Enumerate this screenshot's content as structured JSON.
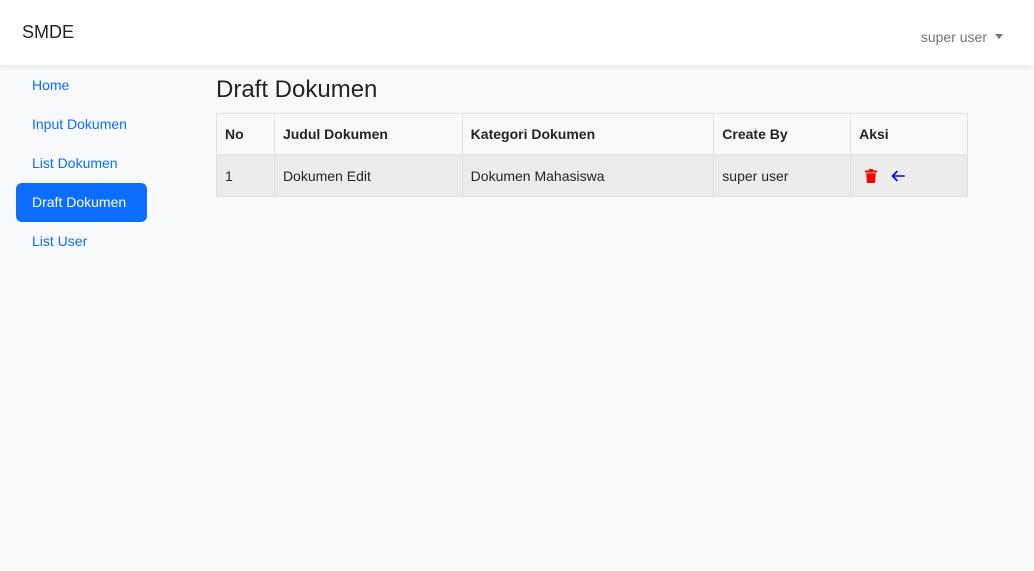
{
  "app": {
    "brand": "SMDE"
  },
  "user_menu": {
    "label": "super user"
  },
  "sidebar": {
    "items": [
      {
        "label": "Home"
      },
      {
        "label": "Input Dokumen"
      },
      {
        "label": "List Dokumen"
      },
      {
        "label": "Draft Dokumen",
        "active": true
      },
      {
        "label": "List User"
      }
    ]
  },
  "page": {
    "title": "Draft Dokumen"
  },
  "table": {
    "headers": [
      "No",
      "Judul Dokumen",
      "Kategori Dokumen",
      "Create By",
      "Aksi"
    ],
    "rows": [
      {
        "no": "1",
        "judul": "Dokumen Edit",
        "kategori": "Dokumen Mahasiswa",
        "create_by": "super user",
        "actions": [
          "trash-icon",
          "arrow-left-icon"
        ]
      }
    ]
  },
  "colors": {
    "primary": "#0d6efd",
    "danger": "#ff0000",
    "restore": "#0000ff"
  }
}
